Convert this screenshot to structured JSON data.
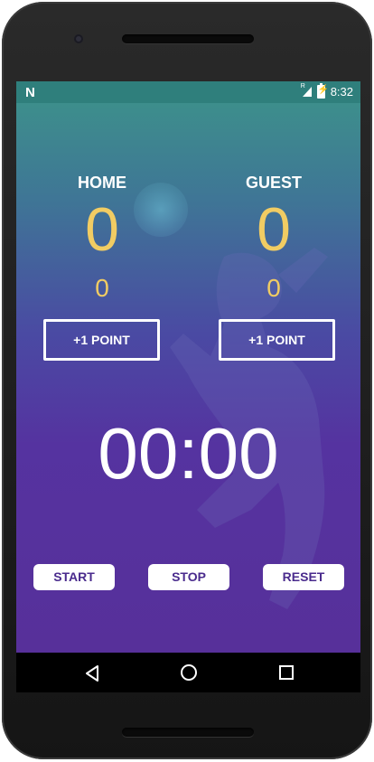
{
  "status_bar": {
    "left_icon": "N",
    "signal_label": "R",
    "time": "8:32",
    "icons": [
      "signal-icon",
      "battery-charging-icon"
    ]
  },
  "home": {
    "label": "HOME",
    "score": "0",
    "sub_score": "0",
    "button_label": "+1 POINT"
  },
  "guest": {
    "label": "GUEST",
    "score": "0",
    "sub_score": "0",
    "button_label": "+1 POINT"
  },
  "timer": {
    "value": "00:00"
  },
  "controls": {
    "start_label": "START",
    "stop_label": "STOP",
    "reset_label": "RESET"
  },
  "nav_bar": {
    "icons": [
      "back-icon",
      "home-icon",
      "recents-icon"
    ]
  },
  "colors": {
    "score": "#f1cc63",
    "status_bar": "#2f7f7c",
    "button_text": "#4a2b8d",
    "gradient_top": "#3d8e8c",
    "gradient_bottom": "#57309a"
  }
}
